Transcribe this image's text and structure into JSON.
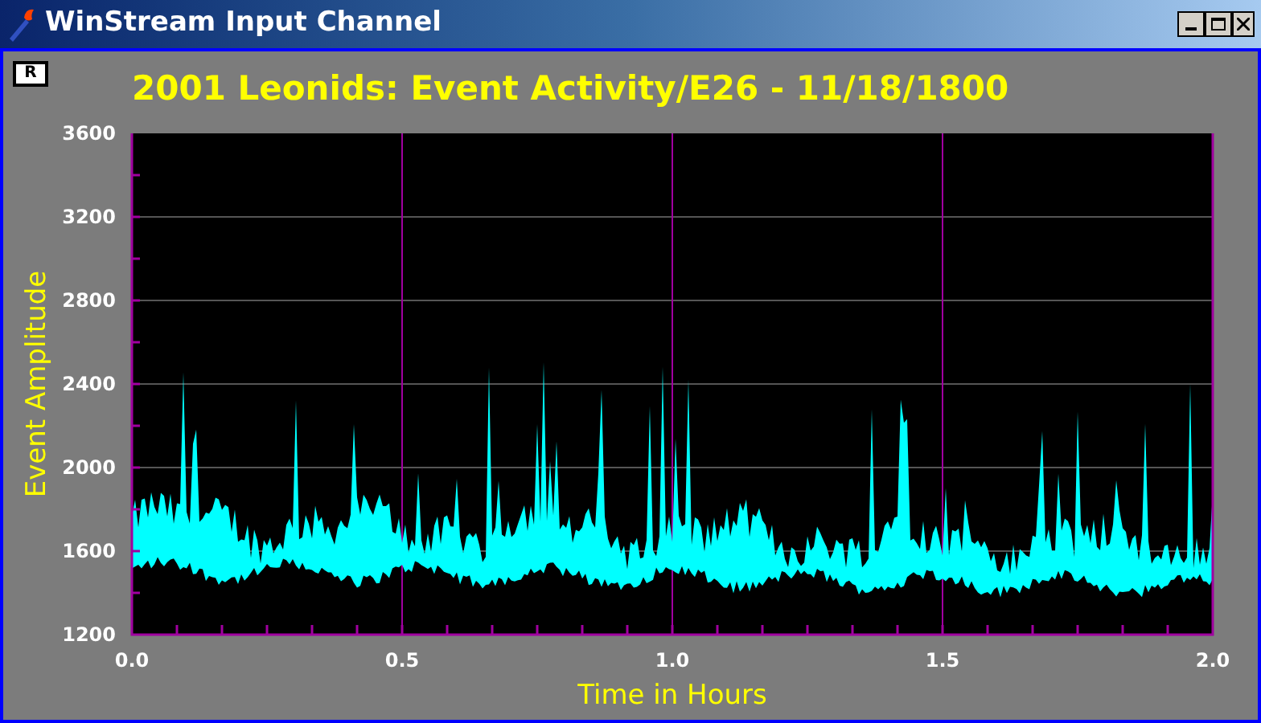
{
  "window": {
    "title": "WinStream Input Channel"
  },
  "toolbar": {
    "button": "R"
  },
  "chart": {
    "title": "2001 Leonids: Event Activity/E26 - 11/18/1800",
    "xlabel": "Time in Hours",
    "ylabel": "Event Amplitude",
    "yticks": [
      "3600",
      "3200",
      "2800",
      "2400",
      "2000",
      "1600",
      "1200"
    ],
    "xticks": [
      "0.0",
      "0.5",
      "1.0",
      "1.5",
      "2.0"
    ]
  }
}
